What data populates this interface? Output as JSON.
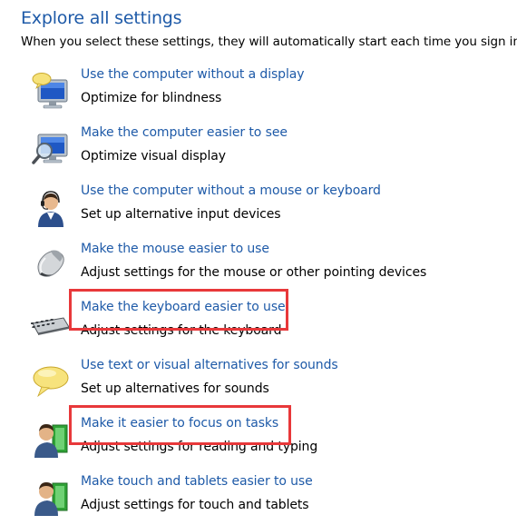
{
  "header": {
    "title": "Explore all settings",
    "subtitle": "When you select these settings, they will automatically start each time you sign in."
  },
  "items": [
    {
      "link": "Use the computer without a display",
      "desc": "Optimize for blindness",
      "icon": "monitor-speech-icon"
    },
    {
      "link": "Make the computer easier to see",
      "desc": "Optimize visual display",
      "icon": "magnifier-monitor-icon"
    },
    {
      "link": "Use the computer without a mouse or keyboard",
      "desc": "Set up alternative input devices",
      "icon": "headset-person-icon"
    },
    {
      "link": "Make the mouse easier to use",
      "desc": "Adjust settings for the mouse or other pointing devices",
      "icon": "mouse-icon"
    },
    {
      "link": "Make the keyboard easier to use",
      "desc": "Adjust settings for the keyboard",
      "icon": "keyboard-icon"
    },
    {
      "link": "Use text or visual alternatives for sounds",
      "desc": "Set up alternatives for sounds",
      "icon": "speech-bubble-icon"
    },
    {
      "link": "Make it easier to focus on tasks",
      "desc": "Adjust settings for reading and typing",
      "icon": "person-book-icon"
    },
    {
      "link": "Make touch and tablets easier to use",
      "desc": "Adjust settings for touch and tablets",
      "icon": "person-tablet-icon"
    }
  ],
  "colors": {
    "link": "#1e5aa8",
    "highlight": "#e8383a"
  }
}
